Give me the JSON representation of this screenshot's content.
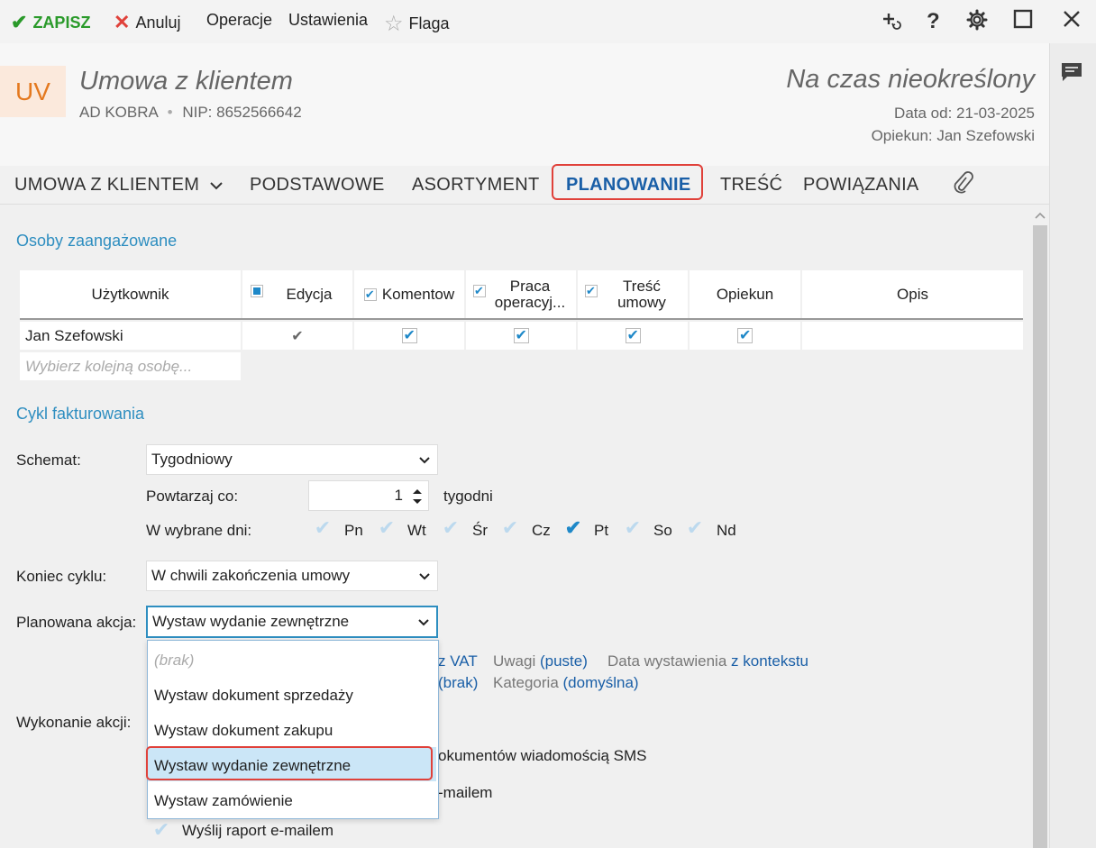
{
  "toolbar": {
    "save_label": "ZAPISZ",
    "cancel_label": "Anuluj",
    "operations_label": "Operacje",
    "settings_label": "Ustawienia",
    "flag_label": "Flaga",
    "icons": [
      "check-icon",
      "close-x-icon",
      "star-icon",
      "add-note-icon",
      "help-icon",
      "gear-icon",
      "maximize-icon",
      "close-window-icon"
    ]
  },
  "header": {
    "logo_text": "UV",
    "title": "Umowa z klientem",
    "company": "AD KOBRA",
    "nip": "NIP: 8652566642",
    "status": "Na czas nieokreślony",
    "date_from": "Data od: 21-03-2025",
    "guardian": "Opiekun: Jan Szefowski"
  },
  "tabs": [
    {
      "label": "UMOWA Z KLIENTEM"
    },
    {
      "label": "PODSTAWOWE"
    },
    {
      "label": "ASORTYMENT"
    },
    {
      "label": "PLANOWANIE"
    },
    {
      "label": "TREŚĆ"
    },
    {
      "label": "POWIĄZANIA"
    }
  ],
  "people": {
    "section_title": "Osoby zaangażowane",
    "columns": {
      "user": "Użytkownik",
      "edit": "Edycja",
      "comment": "Komentow",
      "work_line1": "Praca",
      "work_line2": "operacyj...",
      "content_line1": "Treść",
      "content_line2": "umowy",
      "guardian": "Opiekun",
      "description": "Opis"
    },
    "rows": [
      {
        "name": "Jan Szefowski",
        "edit": true,
        "comment": true,
        "work": true,
        "content": true,
        "guardian": true,
        "description": ""
      }
    ],
    "add_placeholder": "Wybierz kolejną osobę..."
  },
  "billing": {
    "section_title": "Cykl fakturowania",
    "scheme_label": "Schemat:",
    "scheme_value": "Tygodniowy",
    "repeat_label": "Powtarzaj co:",
    "repeat_value": "1",
    "repeat_unit": "tygodni",
    "days_label": "W wybrane dni:",
    "days": [
      {
        "label": "Pn",
        "checked": false
      },
      {
        "label": "Wt",
        "checked": false
      },
      {
        "label": "Śr",
        "checked": false
      },
      {
        "label": "Cz",
        "checked": false
      },
      {
        "label": "Pt",
        "checked": true
      },
      {
        "label": "So",
        "checked": false
      },
      {
        "label": "Nd",
        "checked": false
      }
    ],
    "end_label": "Koniec cyklu:",
    "end_value": "W chwili zakończenia umowy",
    "action_label": "Planowana akcja:",
    "action_value": "Wystaw wydanie zewnętrzne",
    "action_options": [
      "(brak)",
      "Wystaw dokument sprzedaży",
      "Wystaw dokument zakupu",
      "Wystaw wydanie zewnętrzne",
      "Wystaw zamówienie"
    ],
    "selected_option_index": 3,
    "details": {
      "vat_partial": "z VAT",
      "notes_label": "Uwagi",
      "notes_value": "(puste)",
      "issue_date_label": "Data wystawienia",
      "issue_date_value": "z kontekstu",
      "brak_partial": "(brak)",
      "category_label": "Kategoria",
      "category_value": "(domyślna)"
    },
    "execution_label": "Wykonanie akcji:",
    "sms_partial": "okumentów wiadomością SMS",
    "email_partial": "-mailem",
    "report_label": "Wyślij raport e-mailem"
  },
  "colors": {
    "accent": "#1a5fa7",
    "section": "#2e8ec0",
    "highlight": "#e0413a",
    "save_green": "#2a9a2a"
  }
}
